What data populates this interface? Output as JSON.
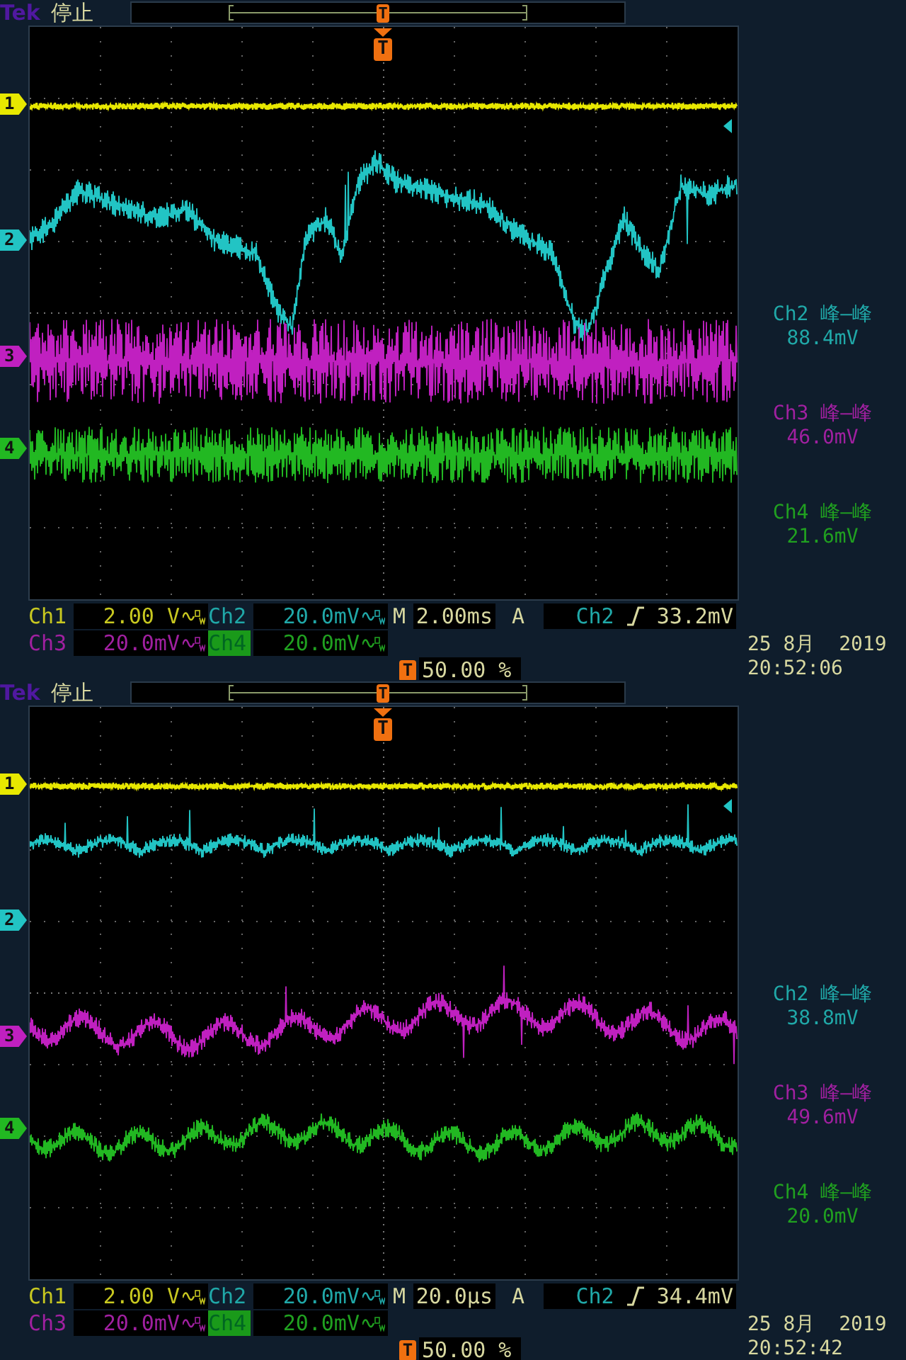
{
  "screens": [
    {
      "brand": "Tek",
      "status": "停止",
      "record_marker": "T",
      "trigger_marker": "T",
      "channels": [
        {
          "label": "1",
          "color": "#e8e800"
        },
        {
          "label": "2",
          "color": "#22c4c4"
        },
        {
          "label": "3",
          "color": "#c020c0"
        },
        {
          "label": "4",
          "color": "#22b822"
        }
      ],
      "measurements": [
        {
          "label": "Ch2 峰—峰",
          "value": "88.4mV",
          "color": "#20a8a8"
        },
        {
          "label": "Ch3 峰—峰",
          "value": "46.0mV",
          "color": "#a020a0"
        },
        {
          "label": "Ch4 峰—峰",
          "value": "21.6mV",
          "color": "#20a020"
        }
      ],
      "scales": [
        {
          "label": "Ch1",
          "value": "2.00 V",
          "color": "#c8c820",
          "selected": false
        },
        {
          "label": "Ch2",
          "value": "20.0mV",
          "color": "#20a8a8",
          "selected": false
        },
        {
          "label": "Ch3",
          "value": "20.0mV",
          "color": "#a020a0",
          "selected": false
        },
        {
          "label": "Ch4",
          "value": "20.0mV",
          "color": "#20a020",
          "selected": true
        }
      ],
      "timebase": {
        "label": "M",
        "value": "2.00ms"
      },
      "trigger": {
        "label": "A",
        "source": "Ch2",
        "threshold": "33.2mV"
      },
      "position": {
        "marker": "T",
        "value": "50.00 %"
      },
      "date": "25 8月  2019",
      "time": "20:52:06"
    },
    {
      "brand": "Tek",
      "status": "停止",
      "record_marker": "T",
      "trigger_marker": "T",
      "channels": [
        {
          "label": "1",
          "color": "#e8e800"
        },
        {
          "label": "2",
          "color": "#22c4c4"
        },
        {
          "label": "3",
          "color": "#c020c0"
        },
        {
          "label": "4",
          "color": "#22b822"
        }
      ],
      "measurements": [
        {
          "label": "Ch2 峰—峰",
          "value": "38.8mV",
          "color": "#20a8a8"
        },
        {
          "label": "Ch3 峰—峰",
          "value": "49.6mV",
          "color": "#a020a0"
        },
        {
          "label": "Ch4 峰—峰",
          "value": "20.0mV",
          "color": "#20a020"
        }
      ],
      "scales": [
        {
          "label": "Ch1",
          "value": "2.00 V",
          "color": "#c8c820",
          "selected": false
        },
        {
          "label": "Ch2",
          "value": "20.0mV",
          "color": "#20a8a8",
          "selected": false
        },
        {
          "label": "Ch3",
          "value": "20.0mV",
          "color": "#a020a0",
          "selected": false
        },
        {
          "label": "Ch4",
          "value": "20.0mV",
          "color": "#20a020",
          "selected": true
        }
      ],
      "timebase": {
        "label": "M",
        "value": "20.0µs"
      },
      "trigger": {
        "label": "A",
        "source": "Ch2",
        "threshold": "34.4mV"
      },
      "position": {
        "marker": "T",
        "value": "50.00 %"
      },
      "date": "25 8月  2019",
      "time": "20:52:42"
    }
  ]
}
